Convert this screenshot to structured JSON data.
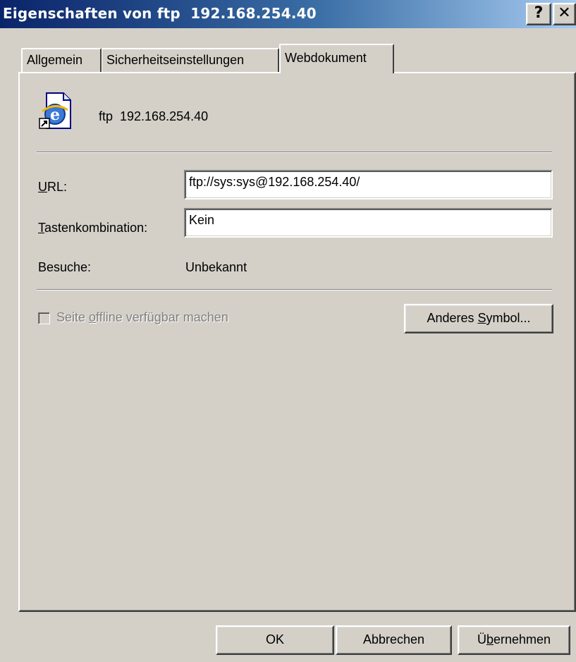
{
  "window": {
    "title": "Eigenschaften von ftp  192.168.254.40",
    "help_glyph": "?",
    "close_glyph": "✕"
  },
  "tabs": [
    {
      "label": "Allgemein",
      "selected": false
    },
    {
      "label": "Sicherheitseinstellungen",
      "selected": false
    },
    {
      "label": "Webdokument",
      "selected": true
    }
  ],
  "document": {
    "icon": "internet-shortcut-icon",
    "name": "ftp  192.168.254.40"
  },
  "fields": {
    "url": {
      "label_mnemonic": "U",
      "label_rest": "RL:",
      "value": "ftp://sys:sys@192.168.254.40/"
    },
    "shortcut": {
      "label_mnemonic": "T",
      "label_rest": "astenkombination:",
      "value": "Kein"
    },
    "visits": {
      "label": "Besuche:",
      "value": "Unbekannt"
    }
  },
  "offline": {
    "label_pre": "Seite ",
    "label_mnemonic": "o",
    "label_post": "ffline verfügbar machen",
    "checked": false,
    "disabled": true
  },
  "buttons": {
    "change_icon": {
      "pre": "Anderes ",
      "mnemonic": "S",
      "post": "ymbol..."
    },
    "ok": "OK",
    "cancel": "Abbrechen",
    "apply": {
      "pre": "Ü",
      "mnemonic": "b",
      "post": "ernehmen"
    }
  },
  "colors": {
    "face": "#d4d0c8",
    "title_start": "#0a246a",
    "title_end": "#a6caf0",
    "disabled_text": "#808080"
  }
}
